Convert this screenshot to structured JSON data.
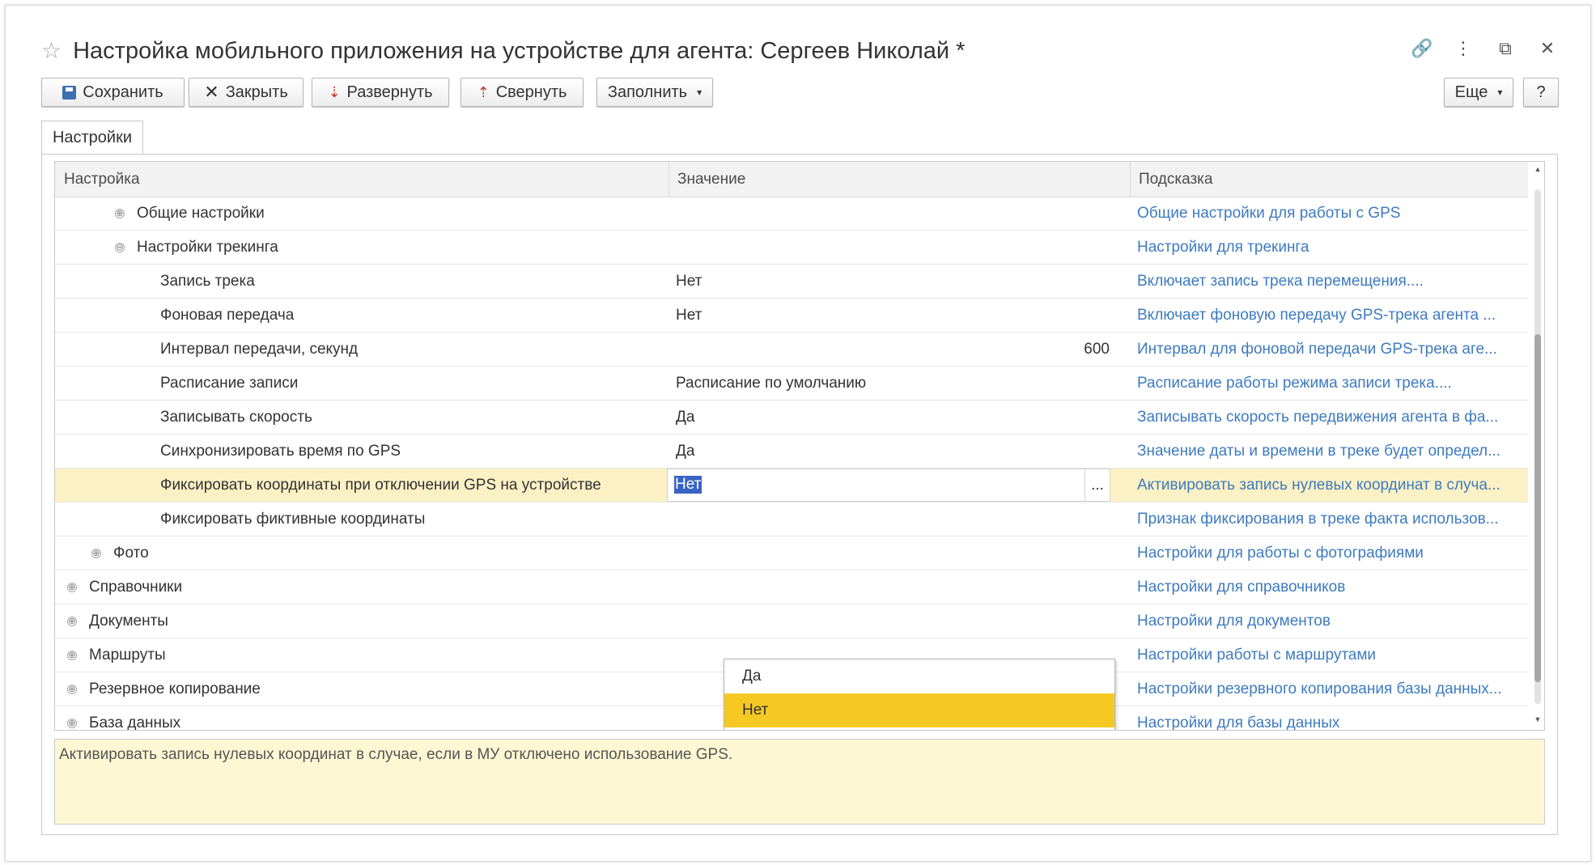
{
  "window": {
    "title": "Настройка мобильного приложения на устройстве для агента: Сергеев Николай *",
    "controls": {
      "link": "🔗",
      "more": "⋮",
      "restore": "⧉",
      "close": "✕"
    }
  },
  "toolbar": {
    "save": "Сохранить",
    "close": "Закрыть",
    "expand": "Развернуть",
    "collapse": "Свернуть",
    "fill": "Заполнить",
    "more": "Еще",
    "help": "?"
  },
  "tab": {
    "label": "Настройки"
  },
  "grid": {
    "headers": [
      "Настройка",
      "Значение",
      "Подсказка"
    ],
    "rows": [
      {
        "name": "Общие настройки",
        "value": "",
        "hint": "Общие настройки для работы с GPS",
        "expander": "⊕"
      },
      {
        "name": "Настройки трекинга",
        "value": "",
        "hint": "Настройки для трекинга",
        "expander": "⊖"
      },
      {
        "name": "Запись трека",
        "value": "Нет",
        "hint": "Включает запись трека перемещения...."
      },
      {
        "name": "Фоновая передача",
        "value": "Нет",
        "hint": "Включает фоновую передачу GPS-трека агента ..."
      },
      {
        "name": "Интервал передачи, секунд",
        "value": "600",
        "hint": "Интервал для фоновой передачи GPS-трека аге..."
      },
      {
        "name": "Расписание записи",
        "value": "Расписание по умолчанию",
        "hint": "Расписание работы режима записи трека...."
      },
      {
        "name": "Записывать скорость",
        "value": "Да",
        "hint": "Записывать скорость передвижения агента в фа..."
      },
      {
        "name": "Синхронизировать время по GPS",
        "value": "Да",
        "hint": "Значение даты и времени в треке будет определ..."
      },
      {
        "name": "Фиксировать координаты при отключении GPS на устройстве",
        "value": "Нет",
        "hint": "Активировать запись нулевых координат в случа..."
      },
      {
        "name": "Фиксировать фиктивные координаты",
        "value": "",
        "hint": "Признак фиксирования в треке факта использов..."
      },
      {
        "name": "Фото",
        "value": "",
        "hint": "Настройки для работы с фотографиями",
        "expander": "⊕"
      },
      {
        "name": "Справочники",
        "value": "",
        "hint": "Настройки для справочников",
        "expander": "⊕"
      },
      {
        "name": "Документы",
        "value": "",
        "hint": "Настройки для документов",
        "expander": "⊕"
      },
      {
        "name": "Маршруты",
        "value": "",
        "hint": "Настройки работы с маршрутами",
        "expander": "⊕"
      },
      {
        "name": "Резервное копирование",
        "value": "",
        "hint": "Настройки резервного копирования базы данных...",
        "expander": "⊕"
      },
      {
        "name": "База данных",
        "value": "",
        "hint": "Настройки для базы данных",
        "expander": "⊕"
      }
    ],
    "editor_button": "..."
  },
  "dropdown": {
    "options": [
      "Да",
      "Нет"
    ],
    "selected": "Нет"
  },
  "hint_panel": {
    "text": "Активировать запись нулевых координат в случае, если в МУ отключено использование GPS."
  },
  "colors": {
    "accent_selection": "#f6c823",
    "row_selected": "#fbf1c5",
    "hint_link": "#3e7bbf"
  }
}
